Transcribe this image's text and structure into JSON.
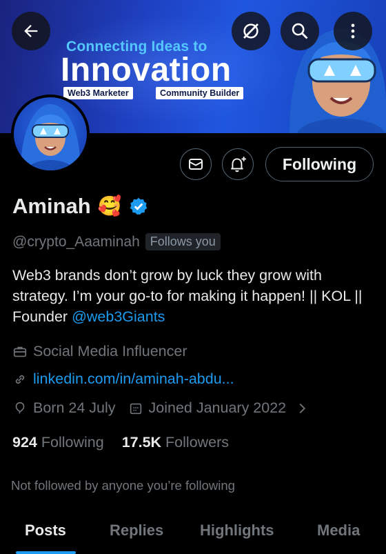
{
  "banner": {
    "subtitle": "Connecting Ideas to",
    "title": "Innovation",
    "tags": [
      "Web3 Marketer",
      "Community Builder"
    ]
  },
  "header_icons": [
    "back-arrow-icon",
    "grok-icon",
    "search-icon",
    "more-vertical-icon"
  ],
  "actions": {
    "following_label": "Following"
  },
  "profile": {
    "name": "Aminah",
    "name_emoji": "🥰",
    "handle": "@crypto_Aaaminah",
    "follows_you": "Follows you",
    "bio_text": "Web3 brands don’t grow by luck they grow with strategy. I’m your go-to for making it happen! || KOL || Founder ",
    "bio_mention": "@web3Giants",
    "job": "Social Media Influencer",
    "link": "linkedin.com/in/aminah-abdu...",
    "born": "Born 24 July",
    "joined": "Joined January 2022",
    "following_count": "924",
    "following_label": "Following",
    "followers_count": "17.5K",
    "followers_label": "Followers",
    "not_followed": "Not followed by anyone you’re following"
  },
  "tabs": [
    {
      "label": "Posts",
      "active": true
    },
    {
      "label": "Replies",
      "active": false
    },
    {
      "label": "Highlights",
      "active": false
    },
    {
      "label": "Media",
      "active": false
    }
  ],
  "colors": {
    "accent": "#1d9bf0",
    "muted": "#71767b",
    "background": "#000000",
    "banner": "#1e3fbf"
  }
}
